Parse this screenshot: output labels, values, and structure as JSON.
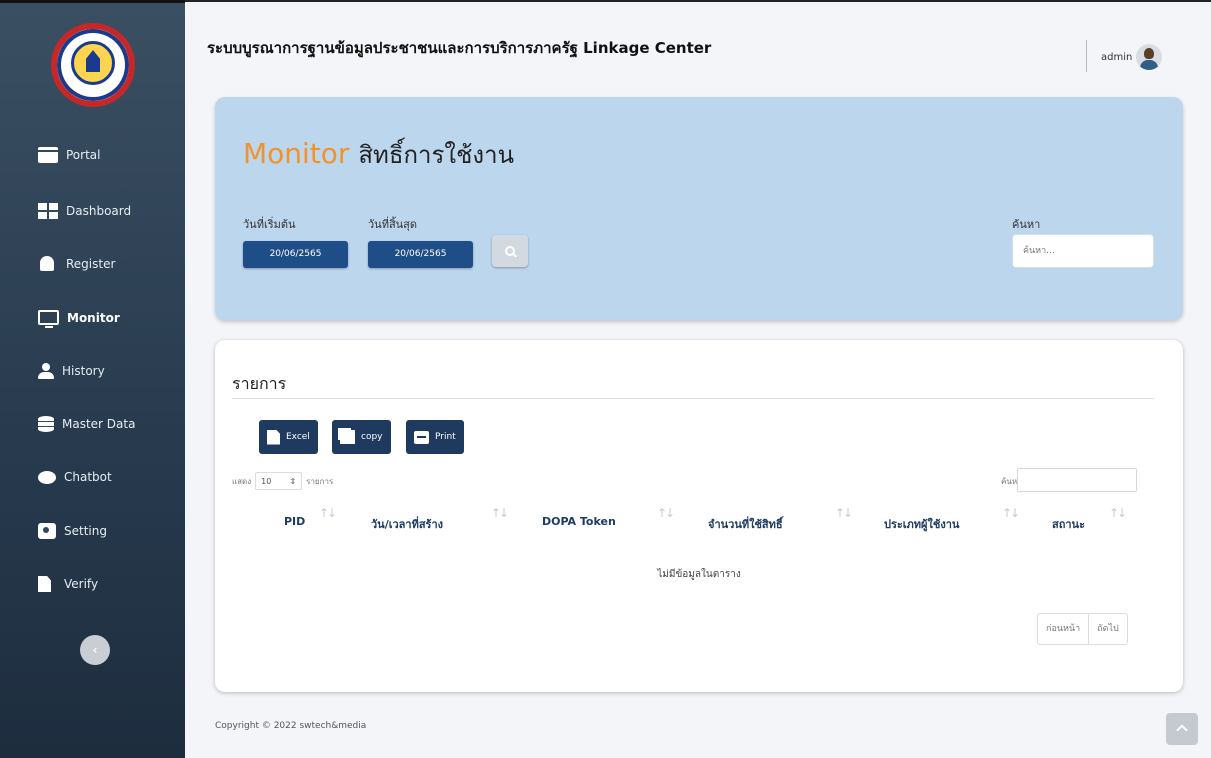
{
  "app": {
    "title": "ระบบบูรณาการฐานข้อมูลประชาชนและการบริการภาครัฐ Linkage Center",
    "user": "admin"
  },
  "sidebar": {
    "items": [
      {
        "label": "Portal",
        "icon": "portal-icon"
      },
      {
        "label": "Dashboard",
        "icon": "dashboard-icon"
      },
      {
        "label": "Register",
        "icon": "bell-icon"
      },
      {
        "label": "Monitor",
        "icon": "monitor-icon",
        "active": true
      },
      {
        "label": "History",
        "icon": "user-icon"
      },
      {
        "label": "Master Data",
        "icon": "database-icon"
      },
      {
        "label": "Chatbot",
        "icon": "chat-icon"
      },
      {
        "label": "Setting",
        "icon": "gear-icon"
      },
      {
        "label": "Verify",
        "icon": "file-icon"
      }
    ]
  },
  "filter": {
    "title_accent": "Monitor",
    "title_rest": "สิทธิ์การใช้งาน",
    "start_label": "วันที่เริ่มต้น",
    "end_label": "วันที่สิ้นสุด",
    "start_value": "20/06/2565",
    "end_value": "20/06/2565",
    "search_label": "ค้นหา",
    "search_placeholder": "ค้นหา..."
  },
  "list": {
    "title": "รายการ",
    "buttons": {
      "excel": "Excel",
      "copy": "copy",
      "print": "Print"
    },
    "length_prefix": "แสดง",
    "length_value": "10",
    "length_suffix": "รายการ",
    "search_label": "ค้นหา:",
    "columns": [
      "PID",
      "วัน/เวลาที่สร้าง",
      "DOPA Token",
      "จำนวนที่ใช้สิทธิ์",
      "ประเภทผู้ใช้งาน",
      "สถานะ"
    ],
    "empty": "ไม่มีข้อมูลในตาราง",
    "pager": {
      "prev": "ก่อนหน้า",
      "next": "ถัดไป"
    }
  },
  "footer": "Copyright © 2022 swtech&media",
  "colors": {
    "accent": "#f2922b",
    "primary": "#1f4d87",
    "card": "#bcd6ee",
    "sidebar": "#2a3d51"
  }
}
